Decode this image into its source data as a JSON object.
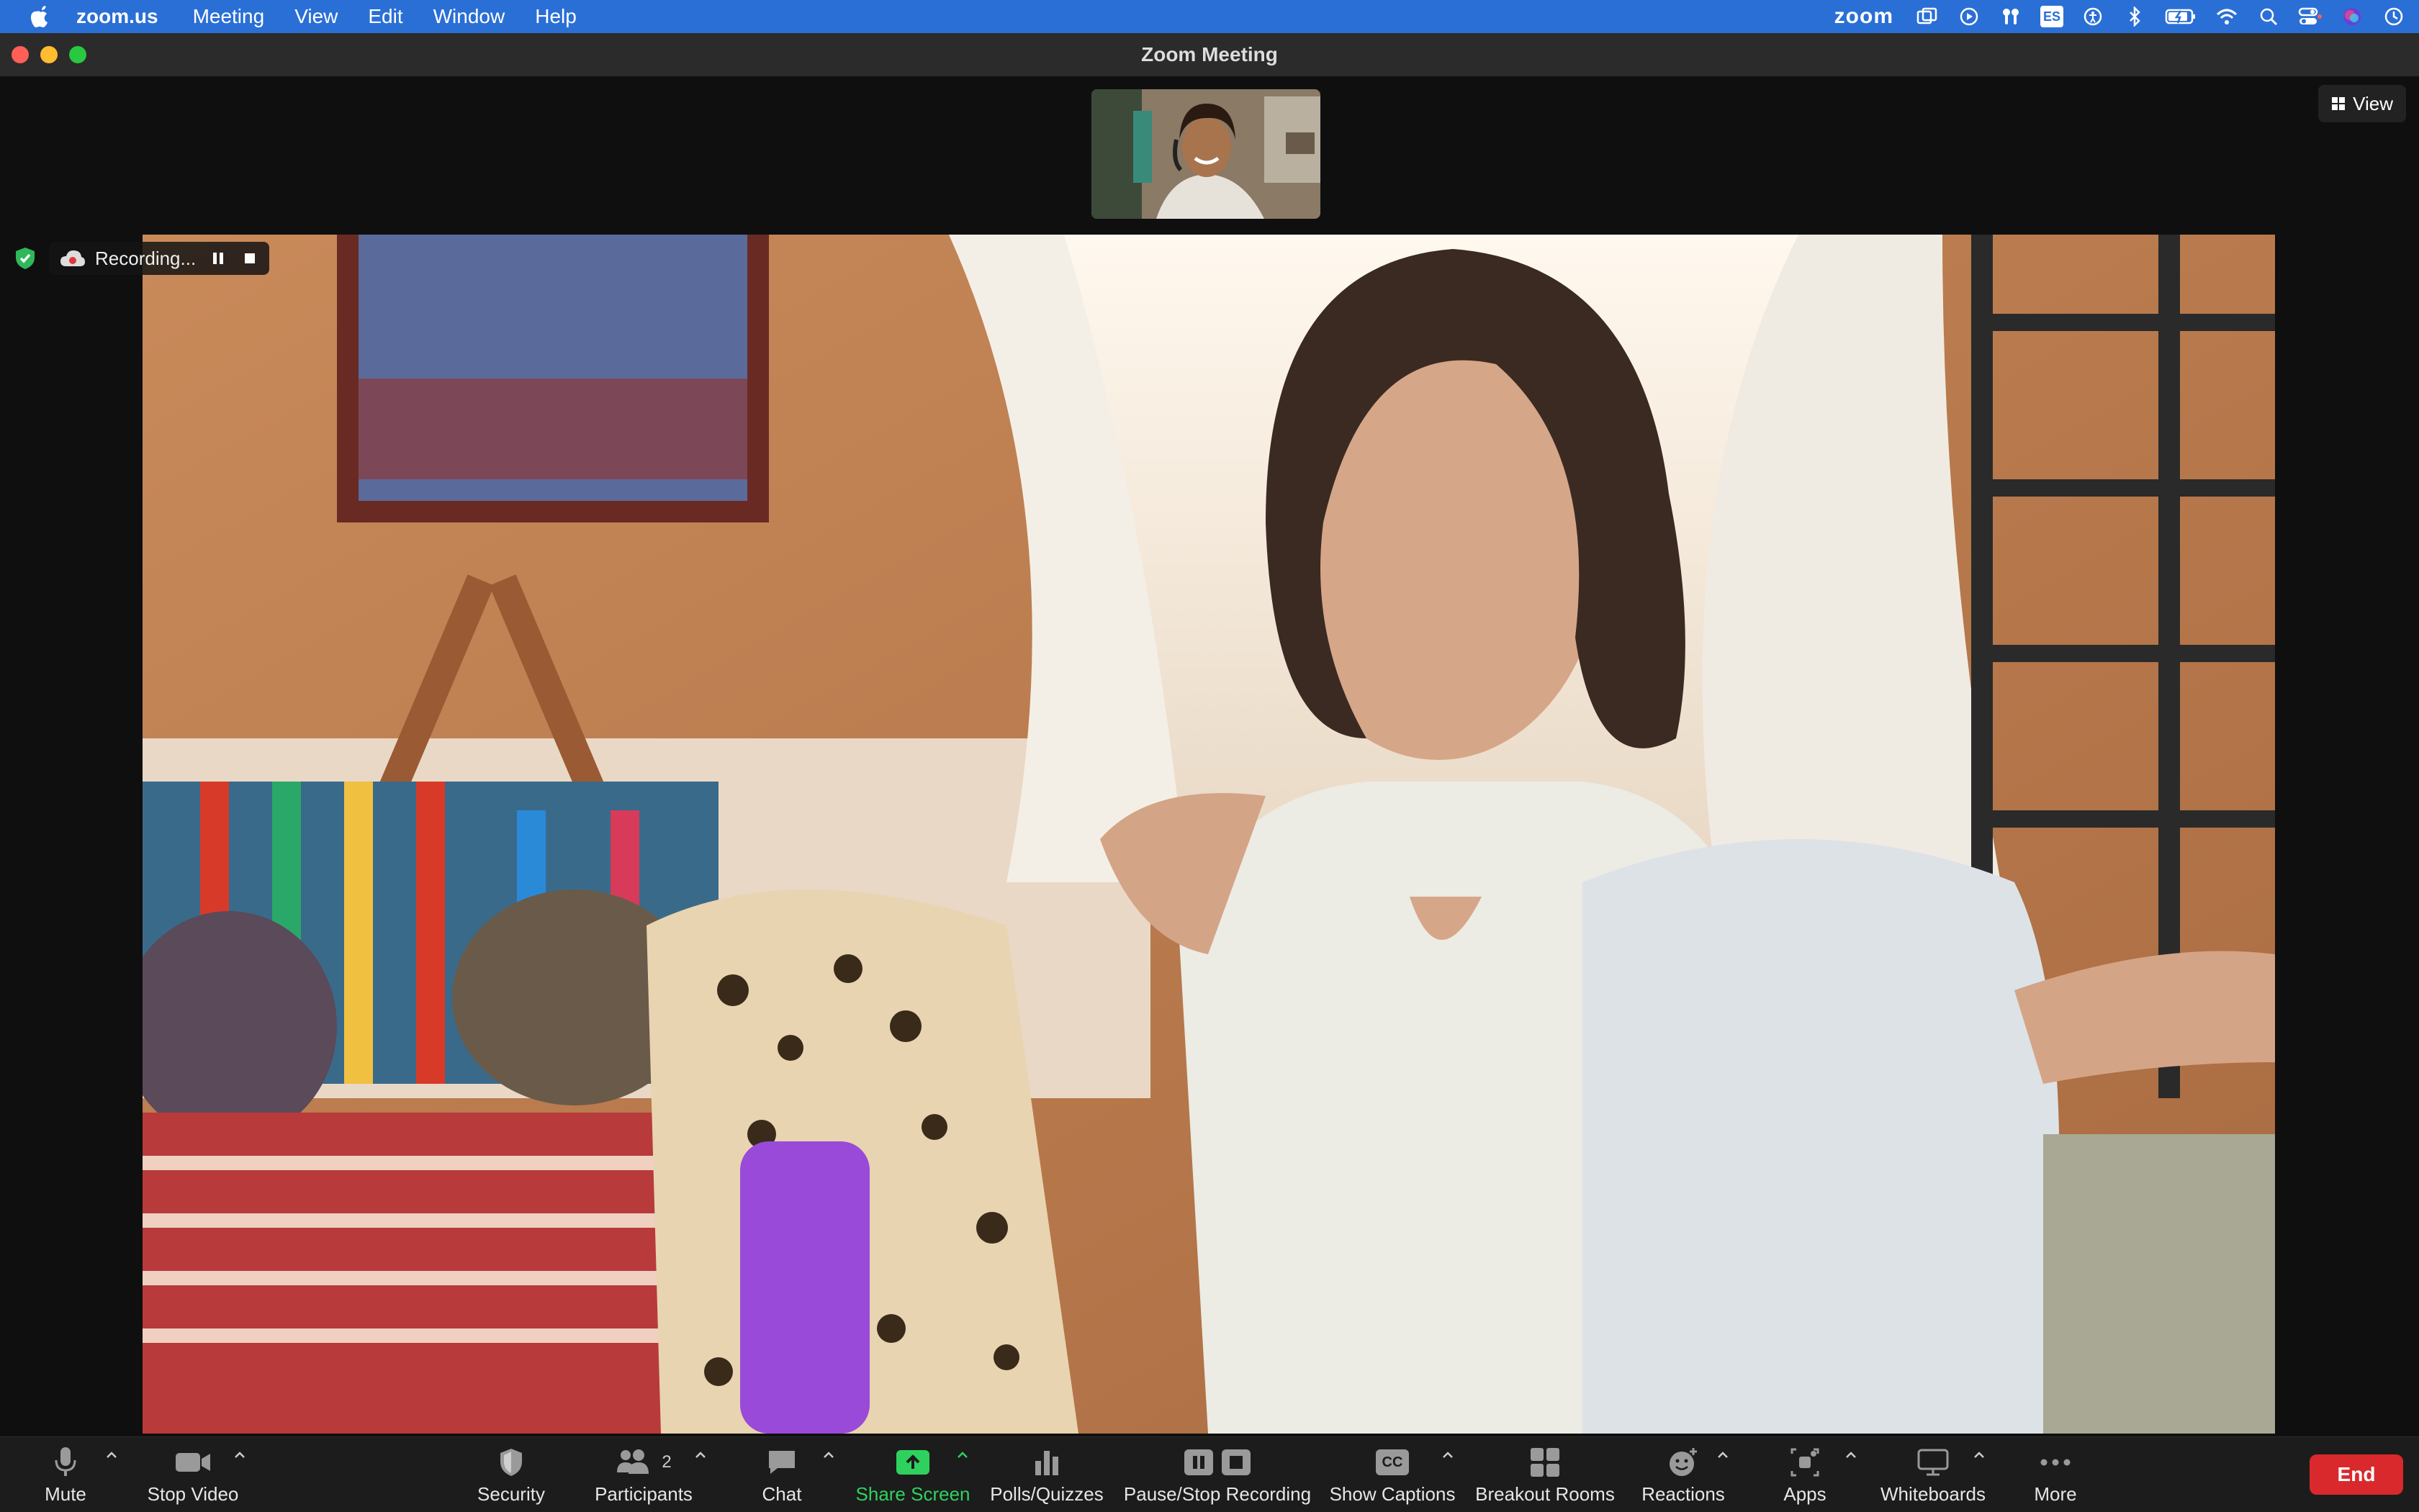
{
  "menubar": {
    "app_name": "zoom.us",
    "items": [
      "Meeting",
      "View",
      "Edit",
      "Window",
      "Help"
    ],
    "status": {
      "zoom_label": "zoom",
      "input_source": "ES"
    }
  },
  "window": {
    "title": "Zoom Meeting"
  },
  "meeting": {
    "view_label": "View",
    "recording_label": "Recording..."
  },
  "toolbar": {
    "mute": "Mute",
    "stop_video": "Stop Video",
    "security": "Security",
    "participants": "Participants",
    "participants_count": "2",
    "chat": "Chat",
    "share_screen": "Share Screen",
    "polls": "Polls/Quizzes",
    "recording": "Pause/Stop Recording",
    "captions": "Show Captions",
    "captions_badge": "CC",
    "breakout": "Breakout Rooms",
    "reactions": "Reactions",
    "apps": "Apps",
    "whiteboards": "Whiteboards",
    "more": "More",
    "end": "End"
  },
  "colors": {
    "menubar_bg": "#2a6fd6",
    "share_green": "#2fd15e",
    "end_red": "#d9292c"
  }
}
